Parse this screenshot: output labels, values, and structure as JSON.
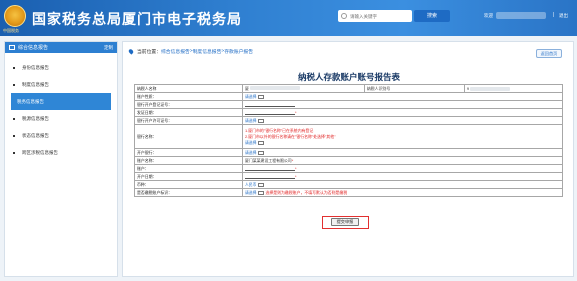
{
  "header": {
    "site_title": "国家税务总局厦门市电子税务局",
    "emblem_label": "中国税务",
    "search_placeholder": "请输入关键字",
    "search_button": "搜索",
    "welcome_prefix": "欢迎",
    "separator": "|",
    "logout": "退出"
  },
  "sidebar": {
    "head_label": "综合信息报告",
    "head_extra": "定制",
    "items": [
      {
        "label": "身份信息报告",
        "active": false
      },
      {
        "label": "制度信息报告",
        "active": false
      },
      {
        "label": "税务信息报告",
        "active": true
      },
      {
        "label": "税源信息报告",
        "active": false
      },
      {
        "label": "状态信息报告",
        "active": false
      },
      {
        "label": "跨区涉税信息报告",
        "active": false
      }
    ]
  },
  "breadcrumb": {
    "prefix": "当前位置：",
    "items": [
      "综合信息报告",
      "制度信息报告",
      "存款账户报告"
    ],
    "separator": " > "
  },
  "return_button": "返回首页",
  "form": {
    "title": "纳税人存款账户账号报告表",
    "rows": [
      {
        "label": "纳税人名称",
        "value": "厦",
        "label2": "纳税人识别号",
        "value2": "9"
      },
      {
        "label": "账户性质：",
        "select": "请选择"
      },
      {
        "label": "银行开户登记证号：",
        "field": ""
      },
      {
        "label": "发证日期：",
        "field": ""
      },
      {
        "label": "银行开户许可证号：",
        "select": "请选择"
      },
      {
        "label": "银行名称：",
        "red_lines": [
          "1.厦门市的\"银行名称\"已在系统内有登记",
          "2.厦门市以外的银行名称请在\"银行名称\"处选择\"其他\""
        ],
        "select": "请选择"
      },
      {
        "label": "开户银行：",
        "select": "请选择"
      },
      {
        "label": "账户名称：",
        "value": "厦门某某建设工程有限公司"
      },
      {
        "label": "账户：",
        "field": ""
      },
      {
        "label": "开户日期：",
        "field": ""
      },
      {
        "label": "币种：",
        "select": "人民币"
      },
      {
        "label": "是否缴税账户标识：",
        "select": "请选择",
        "red_hint": "选择是则为缴税账户，不填写默认为否则是缴税"
      }
    ],
    "submit": "提交申报"
  }
}
